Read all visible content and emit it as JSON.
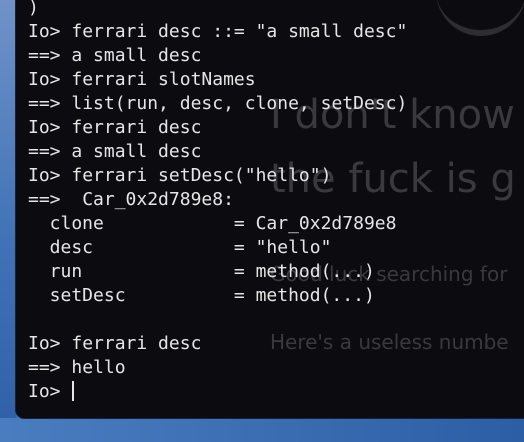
{
  "background_text": {
    "line1": "I don't know",
    "line2": "the fuck is g",
    "line3": "Good luck searching for",
    "line4": "Here's a useless numbe"
  },
  "terminal": {
    "lines": [
      {
        "prompt": "",
        "text": ")"
      },
      {
        "prompt": "Io> ",
        "text": "ferrari desc ::= \"a small desc\""
      },
      {
        "prompt": "==> ",
        "text": "a small desc"
      },
      {
        "prompt": "Io> ",
        "text": "ferrari slotNames"
      },
      {
        "prompt": "==> ",
        "text": "list(run, desc, clone, setDesc)"
      },
      {
        "prompt": "Io> ",
        "text": "ferrari desc"
      },
      {
        "prompt": "==> ",
        "text": "a small desc"
      },
      {
        "prompt": "Io> ",
        "text": "ferrari setDesc(\"hello\")"
      },
      {
        "prompt": "==> ",
        "text": " Car_0x2d789e8:"
      },
      {
        "prompt": "",
        "text": "  clone            = Car_0x2d789e8"
      },
      {
        "prompt": "",
        "text": "  desc             = \"hello\""
      },
      {
        "prompt": "",
        "text": "  run              = method(...)"
      },
      {
        "prompt": "",
        "text": "  setDesc          = method(...)"
      },
      {
        "prompt": "",
        "text": ""
      },
      {
        "prompt": "Io> ",
        "text": "ferrari desc"
      },
      {
        "prompt": "==> ",
        "text": "hello"
      },
      {
        "prompt": "Io> ",
        "text": ""
      }
    ]
  }
}
